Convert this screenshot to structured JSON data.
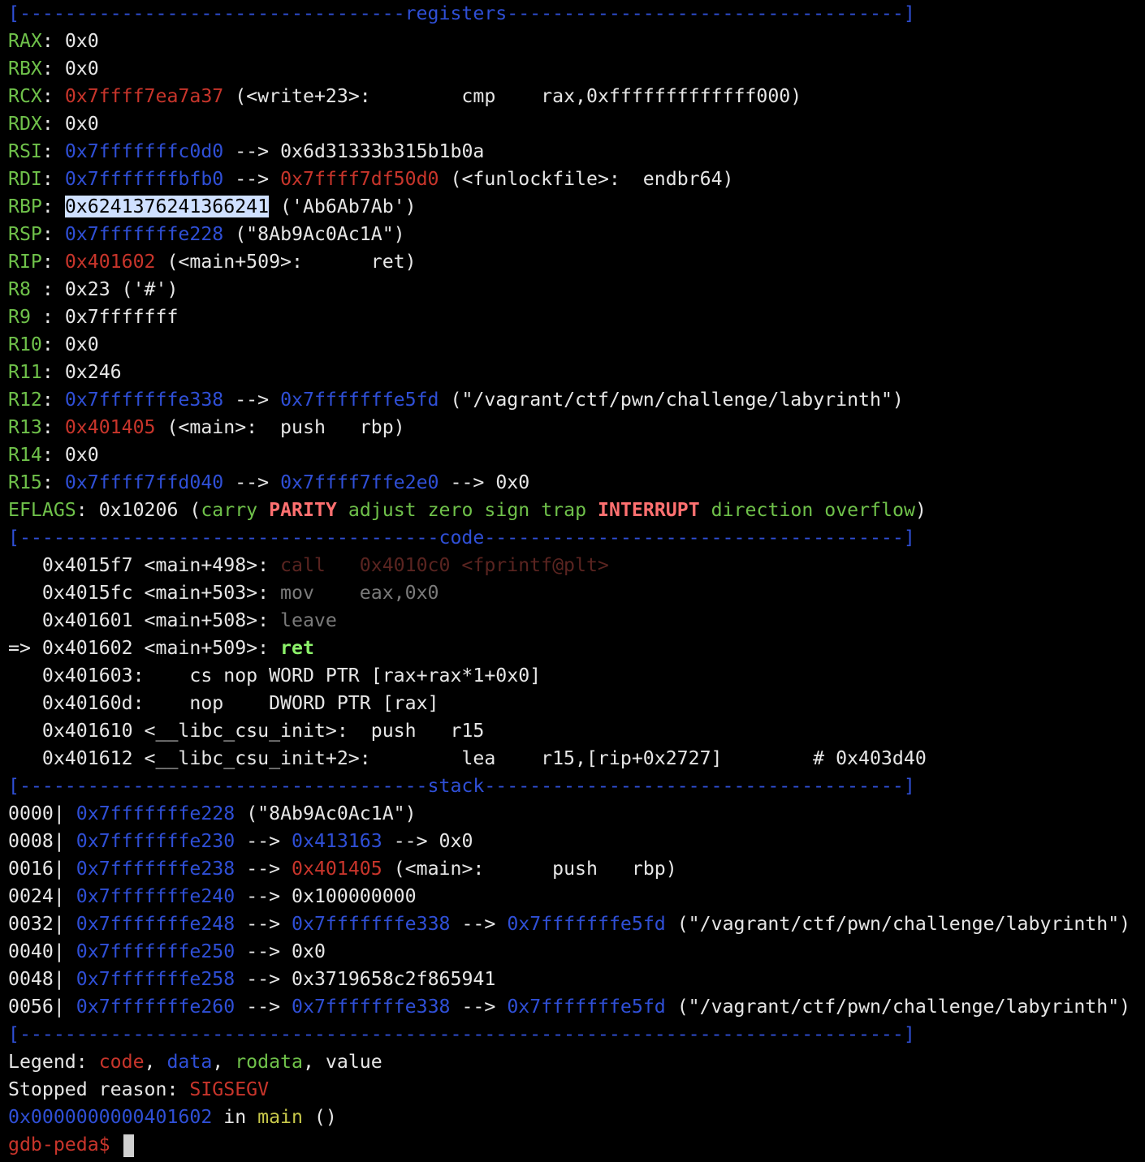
{
  "sections": {
    "registers": "[----------------------------------registers-----------------------------------]",
    "code": "[-------------------------------------code-------------------------------------]",
    "stack": "[------------------------------------stack-------------------------------------]",
    "end": "[------------------------------------------------------------------------------]"
  },
  "registers": {
    "rax": {
      "name": "RAX",
      "value": "0x0"
    },
    "rbx": {
      "name": "RBX",
      "value": "0x0"
    },
    "rcx": {
      "name": "RCX",
      "value": "0x7ffff7ea7a37",
      "info": " (<write+23>:        cmp    rax,0xfffffffffffff000)"
    },
    "rdx": {
      "name": "RDX",
      "value": "0x0"
    },
    "rsi": {
      "name": "RSI",
      "value": "0x7fffffffc0d0",
      "arrow": " --> ",
      "deref": "0x6d31333b315b1b0a"
    },
    "rdi": {
      "name": "RDI",
      "value": "0x7fffffffbfb0",
      "arrow": " --> ",
      "deref": "0x7ffff7df50d0",
      "info": " (<funlockfile>:  endbr64)"
    },
    "rbp": {
      "name": "RBP",
      "value": "0x6241376241366241",
      "info": " ('Ab6Ab7Ab')"
    },
    "rsp": {
      "name": "RSP",
      "value": "0x7fffffffe228",
      "info": " (\"8Ab9Ac0Ac1A\")"
    },
    "rip": {
      "name": "RIP",
      "value": "0x401602",
      "info": " (<main+509>:      ret)"
    },
    "r8": {
      "name": "R8 ",
      "value": "0x23 ('#')"
    },
    "r9": {
      "name": "R9 ",
      "value": "0x7fffffff"
    },
    "r10": {
      "name": "R10",
      "value": "0x0"
    },
    "r11": {
      "name": "R11",
      "value": "0x246"
    },
    "r12": {
      "name": "R12",
      "value": "0x7fffffffe338",
      "arrow": " --> ",
      "deref": "0x7fffffffe5fd",
      "info": " (\"/vagrant/ctf/pwn/challenge/labyrinth\")"
    },
    "r13": {
      "name": "R13",
      "value": "0x401405",
      "info": " (<main>:  push   rbp)"
    },
    "r14": {
      "name": "R14",
      "value": "0x0"
    },
    "r15": {
      "name": "R15",
      "value": "0x7ffff7ffd040",
      "arrow": " --> ",
      "deref": "0x7ffff7ffe2e0",
      "arrow2": " --> ",
      "deref2": "0x0"
    },
    "eflags": {
      "name": "EFLAGS",
      "value": "0x10206",
      "flags": [
        "carry",
        "PARITY",
        "adjust",
        "zero",
        "sign",
        "trap",
        "INTERRUPT",
        "direction",
        "overflow"
      ]
    }
  },
  "code": [
    {
      "prefix": "   ",
      "addr": "0x4015f7 <main+498>:",
      "instr": " call   0x4010c0 <fprintf@plt>"
    },
    {
      "prefix": "   ",
      "addr": "0x4015fc <main+503>:",
      "instr": " mov    eax,0x0"
    },
    {
      "prefix": "   ",
      "addr": "0x401601 <main+508>:",
      "instr": " leave"
    },
    {
      "prefix": "=> ",
      "addr": "0x401602 <main+509>:",
      "instr": " ret"
    },
    {
      "prefix": "   ",
      "addr": "0x401603:",
      "instr": "    cs nop WORD PTR [rax+rax*1+0x0]"
    },
    {
      "prefix": "   ",
      "addr": "0x40160d:",
      "instr": "    nop    DWORD PTR [rax]"
    },
    {
      "prefix": "   ",
      "addr": "0x401610 <__libc_csu_init>:",
      "instr": "  push   r15"
    },
    {
      "prefix": "   ",
      "addr": "0x401612 <__libc_csu_init+2>:",
      "instr": "        lea    r15,[rip+0x2727]        # 0x403d40"
    }
  ],
  "stack": [
    {
      "off": "0000|",
      "addr": "0x7fffffffe228",
      "tail": " (\"8Ab9Ac0Ac1A\")"
    },
    {
      "off": "0008|",
      "addr": "0x7fffffffe230",
      "a1": " --> ",
      "v1": "0x413163",
      "a2": " --> ",
      "v2": "0x0"
    },
    {
      "off": "0016|",
      "addr": "0x7fffffffe238",
      "a1": " --> ",
      "v1": "0x401405",
      "tail": " (<main>:      push   rbp)"
    },
    {
      "off": "0024|",
      "addr": "0x7fffffffe240",
      "a1": " --> ",
      "v2": "0x100000000"
    },
    {
      "off": "0032|",
      "addr": "0x7fffffffe248",
      "a1": " --> ",
      "v1": "0x7fffffffe338",
      "a2": " --> ",
      "v3": "0x7fffffffe5fd",
      "tail": " (\"/vagrant/ctf/pwn/challenge/labyrinth\")"
    },
    {
      "off": "0040|",
      "addr": "0x7fffffffe250",
      "a1": " --> ",
      "v2": "0x0"
    },
    {
      "off": "0048|",
      "addr": "0x7fffffffe258",
      "a1": " --> ",
      "v2": "0x3719658c2f865941"
    },
    {
      "off": "0056|",
      "addr": "0x7fffffffe260",
      "a1": " --> ",
      "v1": "0x7fffffffe338",
      "a2": " --> ",
      "v3": "0x7fffffffe5fd",
      "tail": " (\"/vagrant/ctf/pwn/challenge/labyrinth\")"
    }
  ],
  "footer": {
    "legend_label": "Legend: ",
    "legend_code": "code",
    "legend_data": "data",
    "legend_rodata": "rodata",
    "legend_value": "value",
    "comma": ", ",
    "stopped_label": "Stopped reason: ",
    "stopped_value": "SIGSEGV",
    "loc_addr": "0x0000000000401602",
    "loc_in": " in ",
    "loc_func": "main",
    "loc_args": " ()",
    "prompt": "gdb-peda$ "
  }
}
